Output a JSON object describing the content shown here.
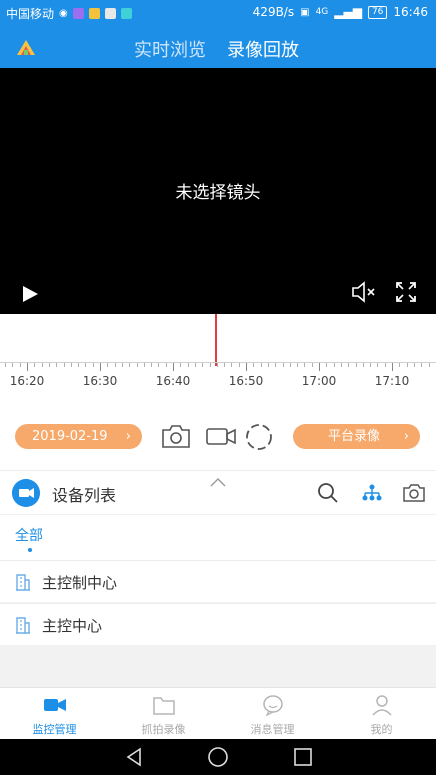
{
  "status_bar": {
    "carrier": "中国移动",
    "speed": "429B/s",
    "network": "4G",
    "battery": "76",
    "time": "16:46"
  },
  "header": {
    "tabs": [
      "实时浏览",
      "录像回放"
    ],
    "active_tab": "录像回放"
  },
  "player": {
    "message": "未选择镜头"
  },
  "timeline": {
    "labels": [
      "16:20",
      "16:30",
      "16:40",
      "16:50",
      "17:00",
      "17:10"
    ]
  },
  "controls": {
    "date": "2019-02-19",
    "chevron": "›",
    "platform_recording": "平台录像"
  },
  "device_list": {
    "title": "设备列表",
    "filter_all": "全部",
    "devices": [
      "主控制中心",
      "主控中心"
    ]
  },
  "bottom_nav": {
    "items": [
      "监控管理",
      "抓拍录像",
      "消息管理",
      "我的"
    ],
    "active": "监控管理"
  },
  "colors": {
    "primary": "#1e8fe6",
    "accent_orange": "#f6a96a",
    "cursor_red": "#e83a3a"
  }
}
